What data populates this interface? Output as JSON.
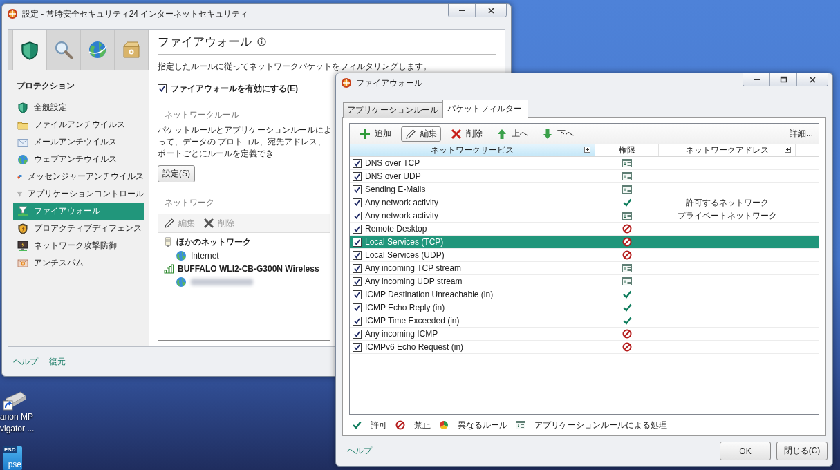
{
  "desktop": {
    "shortcut": {
      "caption_lines": [
        "anon MP",
        "vigator ..."
      ]
    },
    "file_icon": {
      "badge": "PSD",
      "label": "pse"
    }
  },
  "main_window": {
    "title": "設定 - 常時安全セキュリティ24 インターネットセキュリティ",
    "icon_tabs": [
      {
        "kind": "shield",
        "selected": true
      },
      {
        "kind": "search",
        "selected": false
      },
      {
        "kind": "globe",
        "selected": false
      },
      {
        "kind": "box",
        "selected": false
      }
    ],
    "sidebar": {
      "heading": "プロテクション",
      "items": [
        {
          "label": "全般設定",
          "kind": "shield",
          "selected": false
        },
        {
          "label": "ファイルアンチウイルス",
          "kind": "folder",
          "selected": false
        },
        {
          "label": "メールアンチウイルス",
          "kind": "mail",
          "selected": false
        },
        {
          "label": "ウェブアンチウイルス",
          "kind": "globe",
          "selected": false
        },
        {
          "label": "メッセンジャーアンチウイルス",
          "kind": "chat",
          "selected": false
        },
        {
          "label": "アプリケーションコントロール",
          "kind": "funnel",
          "selected": false
        },
        {
          "label": "ファイアウォール",
          "kind": "firewall",
          "selected": true
        },
        {
          "label": "プロアクティブディフェンス",
          "kind": "proactive",
          "selected": false
        },
        {
          "label": "ネットワーク攻撃防御",
          "kind": "monitor",
          "selected": false
        },
        {
          "label": "アンチスパム",
          "kind": "spam",
          "selected": false
        }
      ]
    },
    "pane": {
      "title": "ファイアウォール",
      "description": "指定したルールに従ってネットワークパケットをフィルタリングします。",
      "enable": {
        "label": "ファイアウォールを有効にする(E)",
        "checked": true
      },
      "rules_group": {
        "legend": "ネットワークルール",
        "text": "パケットルールとアプリケーションルールによって、データの プロトコル、宛先アドレス、ポートごとにルールを定義でき",
        "button": "設定(S)"
      },
      "network_group": {
        "legend": "ネットワーク",
        "toolbar": [
          {
            "kind": "edit",
            "label": "編集",
            "disabled": true
          },
          {
            "kind": "delete",
            "label": "削除",
            "disabled": true
          }
        ],
        "tree": [
          {
            "label": "ほかのネットワーク",
            "kind": "adapter",
            "children": [
              {
                "label": "Internet",
                "kind": "globe"
              }
            ]
          },
          {
            "label": "BUFFALO WLI2-CB-G300N Wireless",
            "kind": "signal",
            "children": [
              {
                "kind": "globe",
                "redacted": true
              }
            ]
          }
        ]
      }
    },
    "footer_links": [
      "ヘルプ",
      "復元"
    ]
  },
  "firewall_window": {
    "title": "ファイアウォール",
    "tabs": [
      {
        "label": "アプリケーションルール",
        "selected": false
      },
      {
        "label": "パケットフィルター",
        "selected": true
      }
    ],
    "toolbar": [
      {
        "kind": "add",
        "label": "追加",
        "pressed": false
      },
      {
        "kind": "edit",
        "label": "編集",
        "pressed": true
      },
      {
        "kind": "delete",
        "label": "削除",
        "pressed": false
      },
      {
        "kind": "up",
        "label": "上へ",
        "pressed": false
      },
      {
        "kind": "down",
        "label": "下へ",
        "pressed": false
      }
    ],
    "details_link": "詳細...",
    "columns": [
      {
        "label": "ネットワークサービス",
        "sorted": true,
        "expandable": true
      },
      {
        "label": "権限",
        "sorted": false,
        "expandable": false
      },
      {
        "label": "ネットワークアドレス",
        "sorted": false,
        "expandable": true
      }
    ],
    "rows": [
      {
        "enabled": true,
        "service": "DNS over TCP",
        "permission": {
          "kind": "app"
        },
        "selected": false
      },
      {
        "enabled": true,
        "service": "DNS over UDP",
        "permission": {
          "kind": "app"
        },
        "selected": false
      },
      {
        "enabled": true,
        "service": "Sending E-Mails",
        "permission": {
          "kind": "app"
        },
        "selected": false
      },
      {
        "enabled": true,
        "service": "Any network activity",
        "permission": {
          "kind": "allow"
        },
        "address": "許可するネットワーク",
        "selected": false
      },
      {
        "enabled": true,
        "service": "Any network activity",
        "permission": {
          "kind": "app"
        },
        "address": "プライベートネットワーク",
        "selected": false
      },
      {
        "enabled": true,
        "service": "Remote Desktop",
        "permission": {
          "kind": "block"
        },
        "selected": false
      },
      {
        "enabled": true,
        "service": "Local Services (TCP)",
        "permission": {
          "kind": "block"
        },
        "selected": true
      },
      {
        "enabled": true,
        "service": "Local Services (UDP)",
        "permission": {
          "kind": "block"
        },
        "selected": false
      },
      {
        "enabled": true,
        "service": "Any incoming TCP stream",
        "permission": {
          "kind": "app"
        },
        "selected": false
      },
      {
        "enabled": true,
        "service": "Any incoming UDP stream",
        "permission": {
          "kind": "app"
        },
        "selected": false
      },
      {
        "enabled": true,
        "service": "ICMP Destination Unreachable (in)",
        "permission": {
          "kind": "allow"
        },
        "selected": false
      },
      {
        "enabled": true,
        "service": "ICMP Echo Reply (in)",
        "permission": {
          "kind": "allow"
        },
        "selected": false
      },
      {
        "enabled": true,
        "service": "ICMP Time Exceeded (in)",
        "permission": {
          "kind": "allow"
        },
        "selected": false
      },
      {
        "enabled": true,
        "service": "Any incoming ICMP",
        "permission": {
          "kind": "block"
        },
        "selected": false
      },
      {
        "enabled": true,
        "service": "ICMPv6 Echo Request (in)",
        "permission": {
          "kind": "block"
        },
        "selected": false
      }
    ],
    "legend": [
      {
        "kind": "allow",
        "label": "- 許可"
      },
      {
        "kind": "block",
        "label": "- 禁止"
      },
      {
        "kind": "mixed",
        "label": "- 異なるルール"
      },
      {
        "kind": "app",
        "label": "- アプリケーションルールによる処理"
      }
    ],
    "help_link": "ヘルプ",
    "buttons": [
      "OK",
      "閉じる(C)"
    ]
  }
}
